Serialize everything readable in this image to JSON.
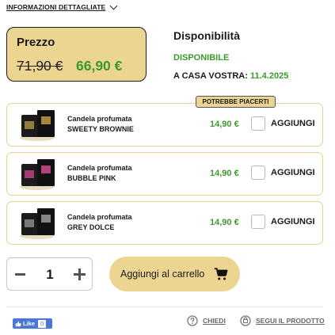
{
  "details": {
    "label": "INFORMAZIONI DETTAGLIATE"
  },
  "price": {
    "label": "Prezzo",
    "old": "71,90 €",
    "new": "66,90 €"
  },
  "availability": {
    "title": "Disponibilità",
    "status": "DISPONIBILE",
    "home_label": "A CASA VOSTRA:",
    "home_date": "11.4.2025"
  },
  "recommended": {
    "badge": "POTREBBE PIACERTI",
    "items": [
      {
        "line1": "Candela profumata",
        "line2": "SWEETY BROWNIE",
        "price": "14,90 €",
        "add_label": "AGGIUNGI",
        "checked": false,
        "accent": "#c9a24a"
      },
      {
        "line1": "Candela profumata",
        "line2": "BUBBLE PINK",
        "price": "14,90 €",
        "add_label": "AGGIUNGI",
        "checked": false,
        "accent": "#d24a8f"
      },
      {
        "line1": "Candela profumata",
        "line2": "GREY DOLCE",
        "price": "14,90 €",
        "add_label": "AGGIUNGI",
        "checked": false,
        "accent": "#9a9a9a"
      }
    ]
  },
  "quantity": {
    "value": "1"
  },
  "cart": {
    "label": "Aggiungi al carrello"
  },
  "footer": {
    "like_label": "Like",
    "like_count": "0",
    "ask_label": "CHIEDI",
    "follow_label": "SEGUI IL PRODOTTO"
  },
  "colors": {
    "accent": "#ecd590",
    "green": "#3b9a2c",
    "facebook": "#4a76d6"
  }
}
